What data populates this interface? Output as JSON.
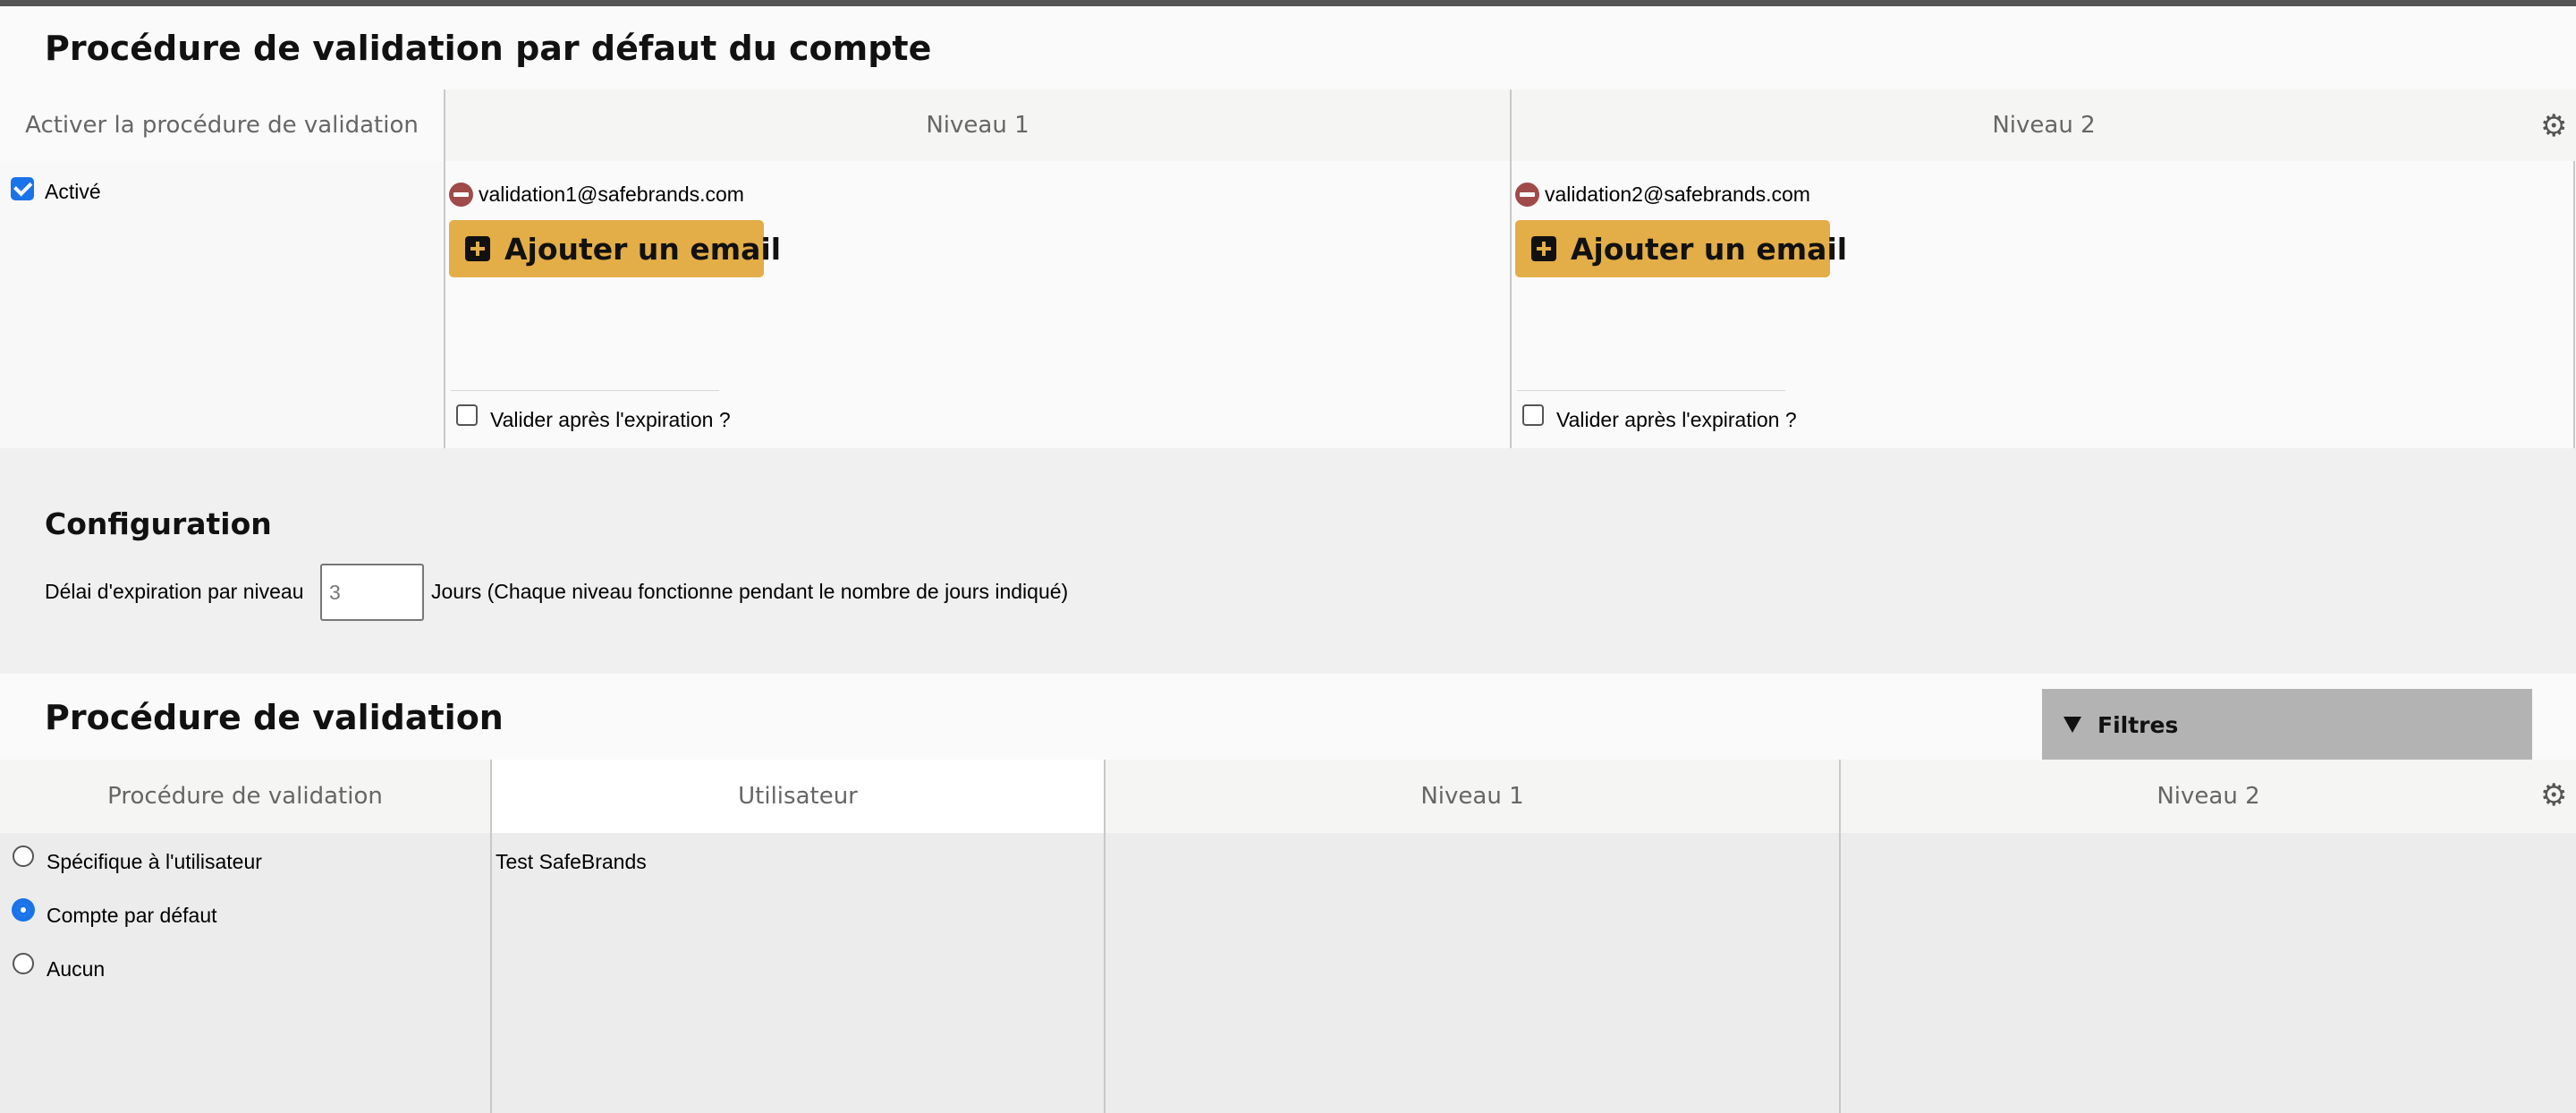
{
  "section_default": {
    "title": "Procédure de validation par défaut du compte",
    "columns": {
      "activate": "Activer la procédure de validation",
      "level1": "Niveau 1",
      "level2": "Niveau 2"
    },
    "activated_label": "Activé",
    "activated_checked": true,
    "level1": {
      "email": "validation1@safebrands.com",
      "add_button": "Ajouter un email",
      "expire_label": "Valider après l'expiration ?"
    },
    "level2": {
      "email": "validation2@safebrands.com",
      "add_button": "Ajouter un email",
      "expire_label": "Valider après l'expiration ?"
    },
    "settings_icon": "gear-icon"
  },
  "configuration": {
    "title": "Configuration",
    "delay_label": "Délai d'expiration par niveau",
    "delay_value": "3",
    "delay_suffix": "Jours (Chaque niveau fonctionne pendant le nombre de jours indiqué)"
  },
  "section_procedure": {
    "title": "Procédure de validation",
    "filter_button": "Filtres",
    "columns": {
      "procedure": "Procédure de validation",
      "user": "Utilisateur",
      "level1": "Niveau 1",
      "level2": "Niveau 2"
    },
    "options": [
      {
        "label": "Spécifique à l'utilisateur",
        "selected": false
      },
      {
        "label": "Compte par défaut",
        "selected": true
      },
      {
        "label": "Aucun",
        "selected": false
      }
    ],
    "user": "Test SafeBrands",
    "settings_icon": "gear-icon"
  },
  "colors": {
    "accent_button": "#e3ad47",
    "remove_icon": "#a04a4a",
    "checkbox_blue": "#1a73e8",
    "filter_bg": "#b3b3b3"
  }
}
